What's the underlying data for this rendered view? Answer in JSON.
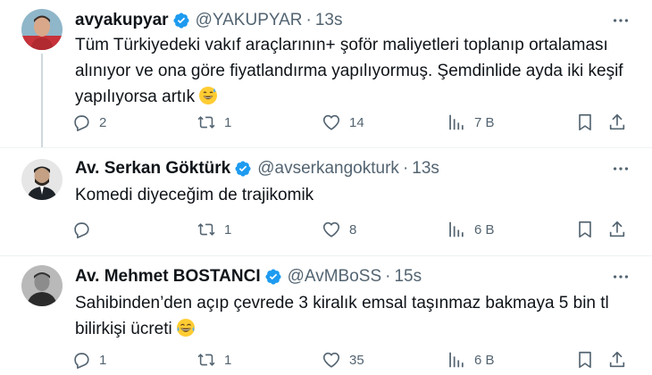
{
  "colors": {
    "text": "#0f1419",
    "secondary": "#536471",
    "verified": "#1d9bf0",
    "divider": "#eff3f4"
  },
  "tweets": [
    {
      "name": "avyakupyar",
      "handle": "@YAKUPYAR",
      "separator": "·",
      "time": "13s",
      "text_lines": [
        "Tüm Türkiyedeki vakıf araçlarının+ şoför maliyetleri toplanıp ortalaması",
        "alınıyor ve ona göre fiyatlandırma yapılıyormuş. Şemdinlide ayda iki keşif",
        "yapılıyorsa artık"
      ],
      "emoji": "sweat-smile-emoji",
      "replies": "2",
      "retweets": "1",
      "likes": "14",
      "views": "7 B",
      "views_icon": "analytics-icon"
    },
    {
      "name": "Av. Serkan Göktürk",
      "handle": "@avserkangokturk",
      "separator": "·",
      "time": "13s",
      "text_lines": [
        "Komedi diyeceğim de trajikomik"
      ],
      "replies": "",
      "retweets": "1",
      "likes": "8",
      "views": "6 B",
      "views_icon": "analytics-icon"
    },
    {
      "name": "Av. Mehmet BOSTANCI",
      "handle": "@AvMBoSS",
      "separator": "·",
      "time": "15s",
      "text_lines": [
        "Sahibinden’den açıp çevrede 3 kiralık emsal taşınmaz bakmaya 5 bin tl",
        "bilirkişi ücreti"
      ],
      "emoji": "crying-laughing-emoji",
      "replies": "1",
      "retweets": "1",
      "likes": "35",
      "views": "6 B",
      "views_icon": "analytics-icon"
    }
  ]
}
